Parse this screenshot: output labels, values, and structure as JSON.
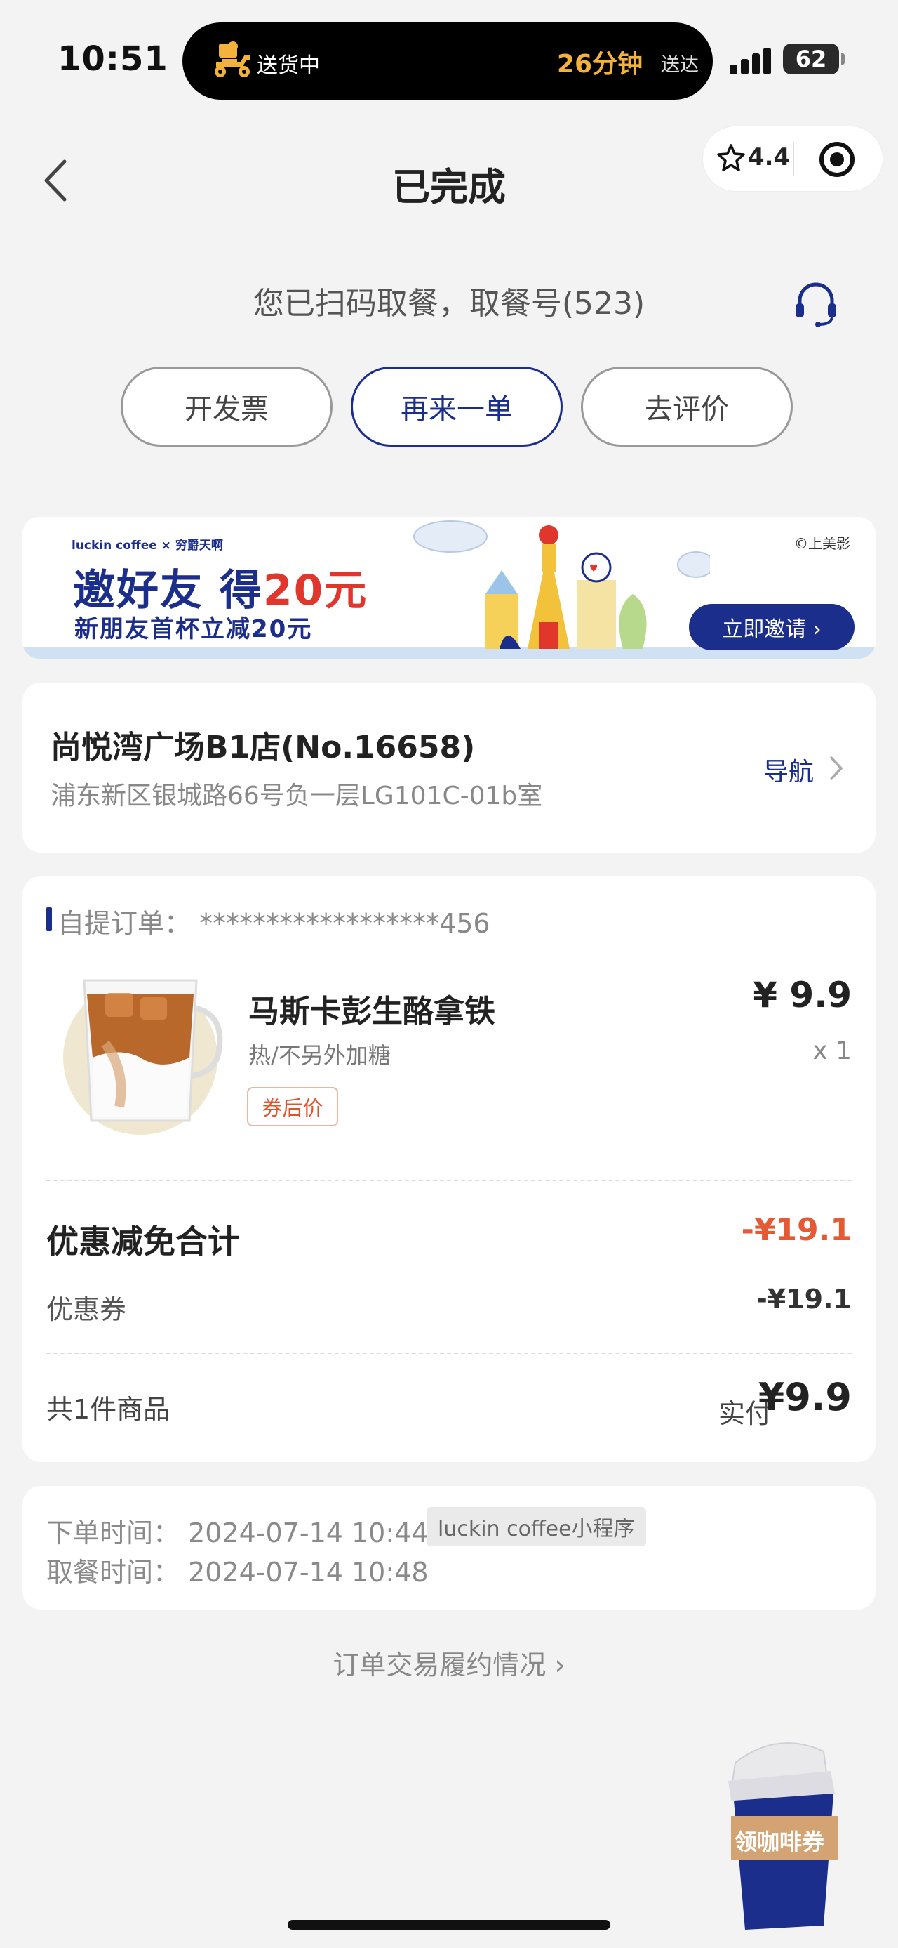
{
  "status_bar": {
    "time": "10:51",
    "delivery_status": "送货中",
    "eta": "26分钟",
    "eta_suffix": "送达",
    "battery": "62"
  },
  "nav": {
    "title": "已完成",
    "rating": "4.4"
  },
  "pickup": {
    "message": "您已扫码取餐，取餐号(523)"
  },
  "actions": {
    "invoice": "开发票",
    "reorder": "再来一单",
    "review": "去评价"
  },
  "banner": {
    "brand": "luckin coffee × 穷爵天啊",
    "headline_pre": "邀好友 得",
    "headline_amount": "20元",
    "sub": "新朋友首杯立减20元",
    "copyright": "©上美影",
    "cta": "立即邀请 ›"
  },
  "store": {
    "name": "尚悦湾广场B1店(No.16658)",
    "address": "浦东新区银城路66号负一层LG101C-01b室",
    "nav_label": "导航"
  },
  "order": {
    "label": "自提订单：  ******************456",
    "product_name": "马斯卡彭生酪拿铁",
    "product_options": "热/不另外加糖",
    "after_coupon_tag": "券后价",
    "price": "¥ 9.9",
    "quantity": "x 1",
    "discount_title": "优惠减免合计",
    "discount_total": "-¥19.1",
    "coupon_label": "优惠券",
    "coupon_value": "-¥19.1",
    "item_count": "共1件商品",
    "paid_label": "实付",
    "paid_value": "¥9.9"
  },
  "times": {
    "order_time": "下单时间：  2024-07-14 10:44",
    "channel": "luckin coffee小程序",
    "pickup_time": "取餐时间：  2024-07-14 10:48"
  },
  "footer": {
    "trade_link": "订单交易履约情况 ›"
  },
  "floating": {
    "coupon_cup": "领咖啡券"
  },
  "colors": {
    "brand_blue": "#1b2e8c",
    "discount_red": "#e35a34",
    "eta_orange": "#f3b23b",
    "background": "#f3f3f3"
  }
}
